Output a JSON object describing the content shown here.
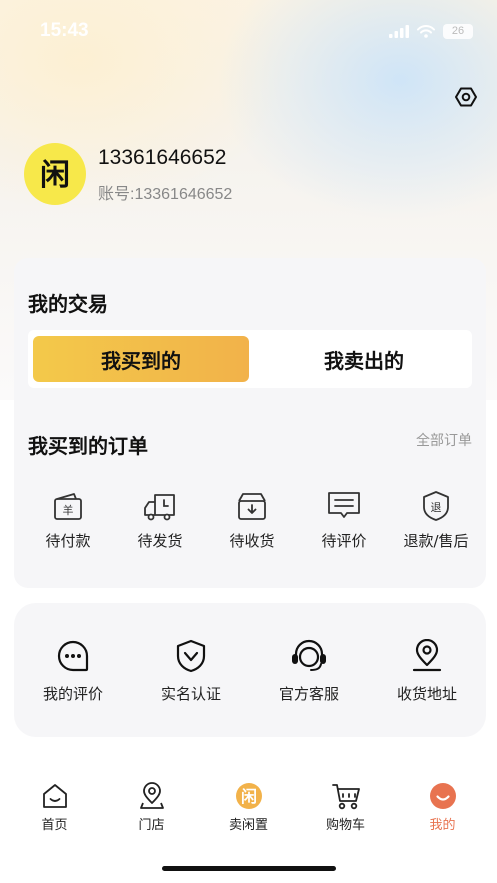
{
  "status_bar": {
    "time": "15:43",
    "battery": "26"
  },
  "profile": {
    "avatar_char": "闲",
    "name": "13361646652",
    "account": "账号:13361646652"
  },
  "trade": {
    "title": "我的交易",
    "segment_active": "我买到的",
    "segment_inactive": "我卖出的"
  },
  "orders": {
    "title": "我买到的订单",
    "all_link": "全部订单",
    "items": [
      {
        "label": "待付款",
        "icon": "wallet-icon",
        "icon_text": "羊"
      },
      {
        "label": "待发货",
        "icon": "delivery-truck-icon"
      },
      {
        "label": "待收货",
        "icon": "box-receive-icon"
      },
      {
        "label": "待评价",
        "icon": "review-icon"
      },
      {
        "label": "退款/售后",
        "icon": "refund-icon",
        "icon_text": "退"
      }
    ]
  },
  "services": {
    "items": [
      {
        "label": "我的评价",
        "icon": "chat-bubble-icon"
      },
      {
        "label": "实名认证",
        "icon": "shield-check-icon"
      },
      {
        "label": "官方客服",
        "icon": "headset-icon"
      },
      {
        "label": "收货地址",
        "icon": "location-pin-icon"
      }
    ]
  },
  "tabbar": {
    "items": [
      {
        "label": "首页",
        "icon": "home-icon",
        "active": false
      },
      {
        "label": "门店",
        "icon": "store-location-icon",
        "active": false
      },
      {
        "label": "卖闲置",
        "icon": "sell-idle-icon",
        "icon_text": "闲",
        "active": false
      },
      {
        "label": "购物车",
        "icon": "cart-icon",
        "active": false
      },
      {
        "label": "我的",
        "icon": "profile-icon",
        "active": true
      }
    ]
  },
  "colors": {
    "accent_yellow": "#f3c94a",
    "active_tab": "#e87350",
    "avatar_bg": "#f7e84a"
  }
}
